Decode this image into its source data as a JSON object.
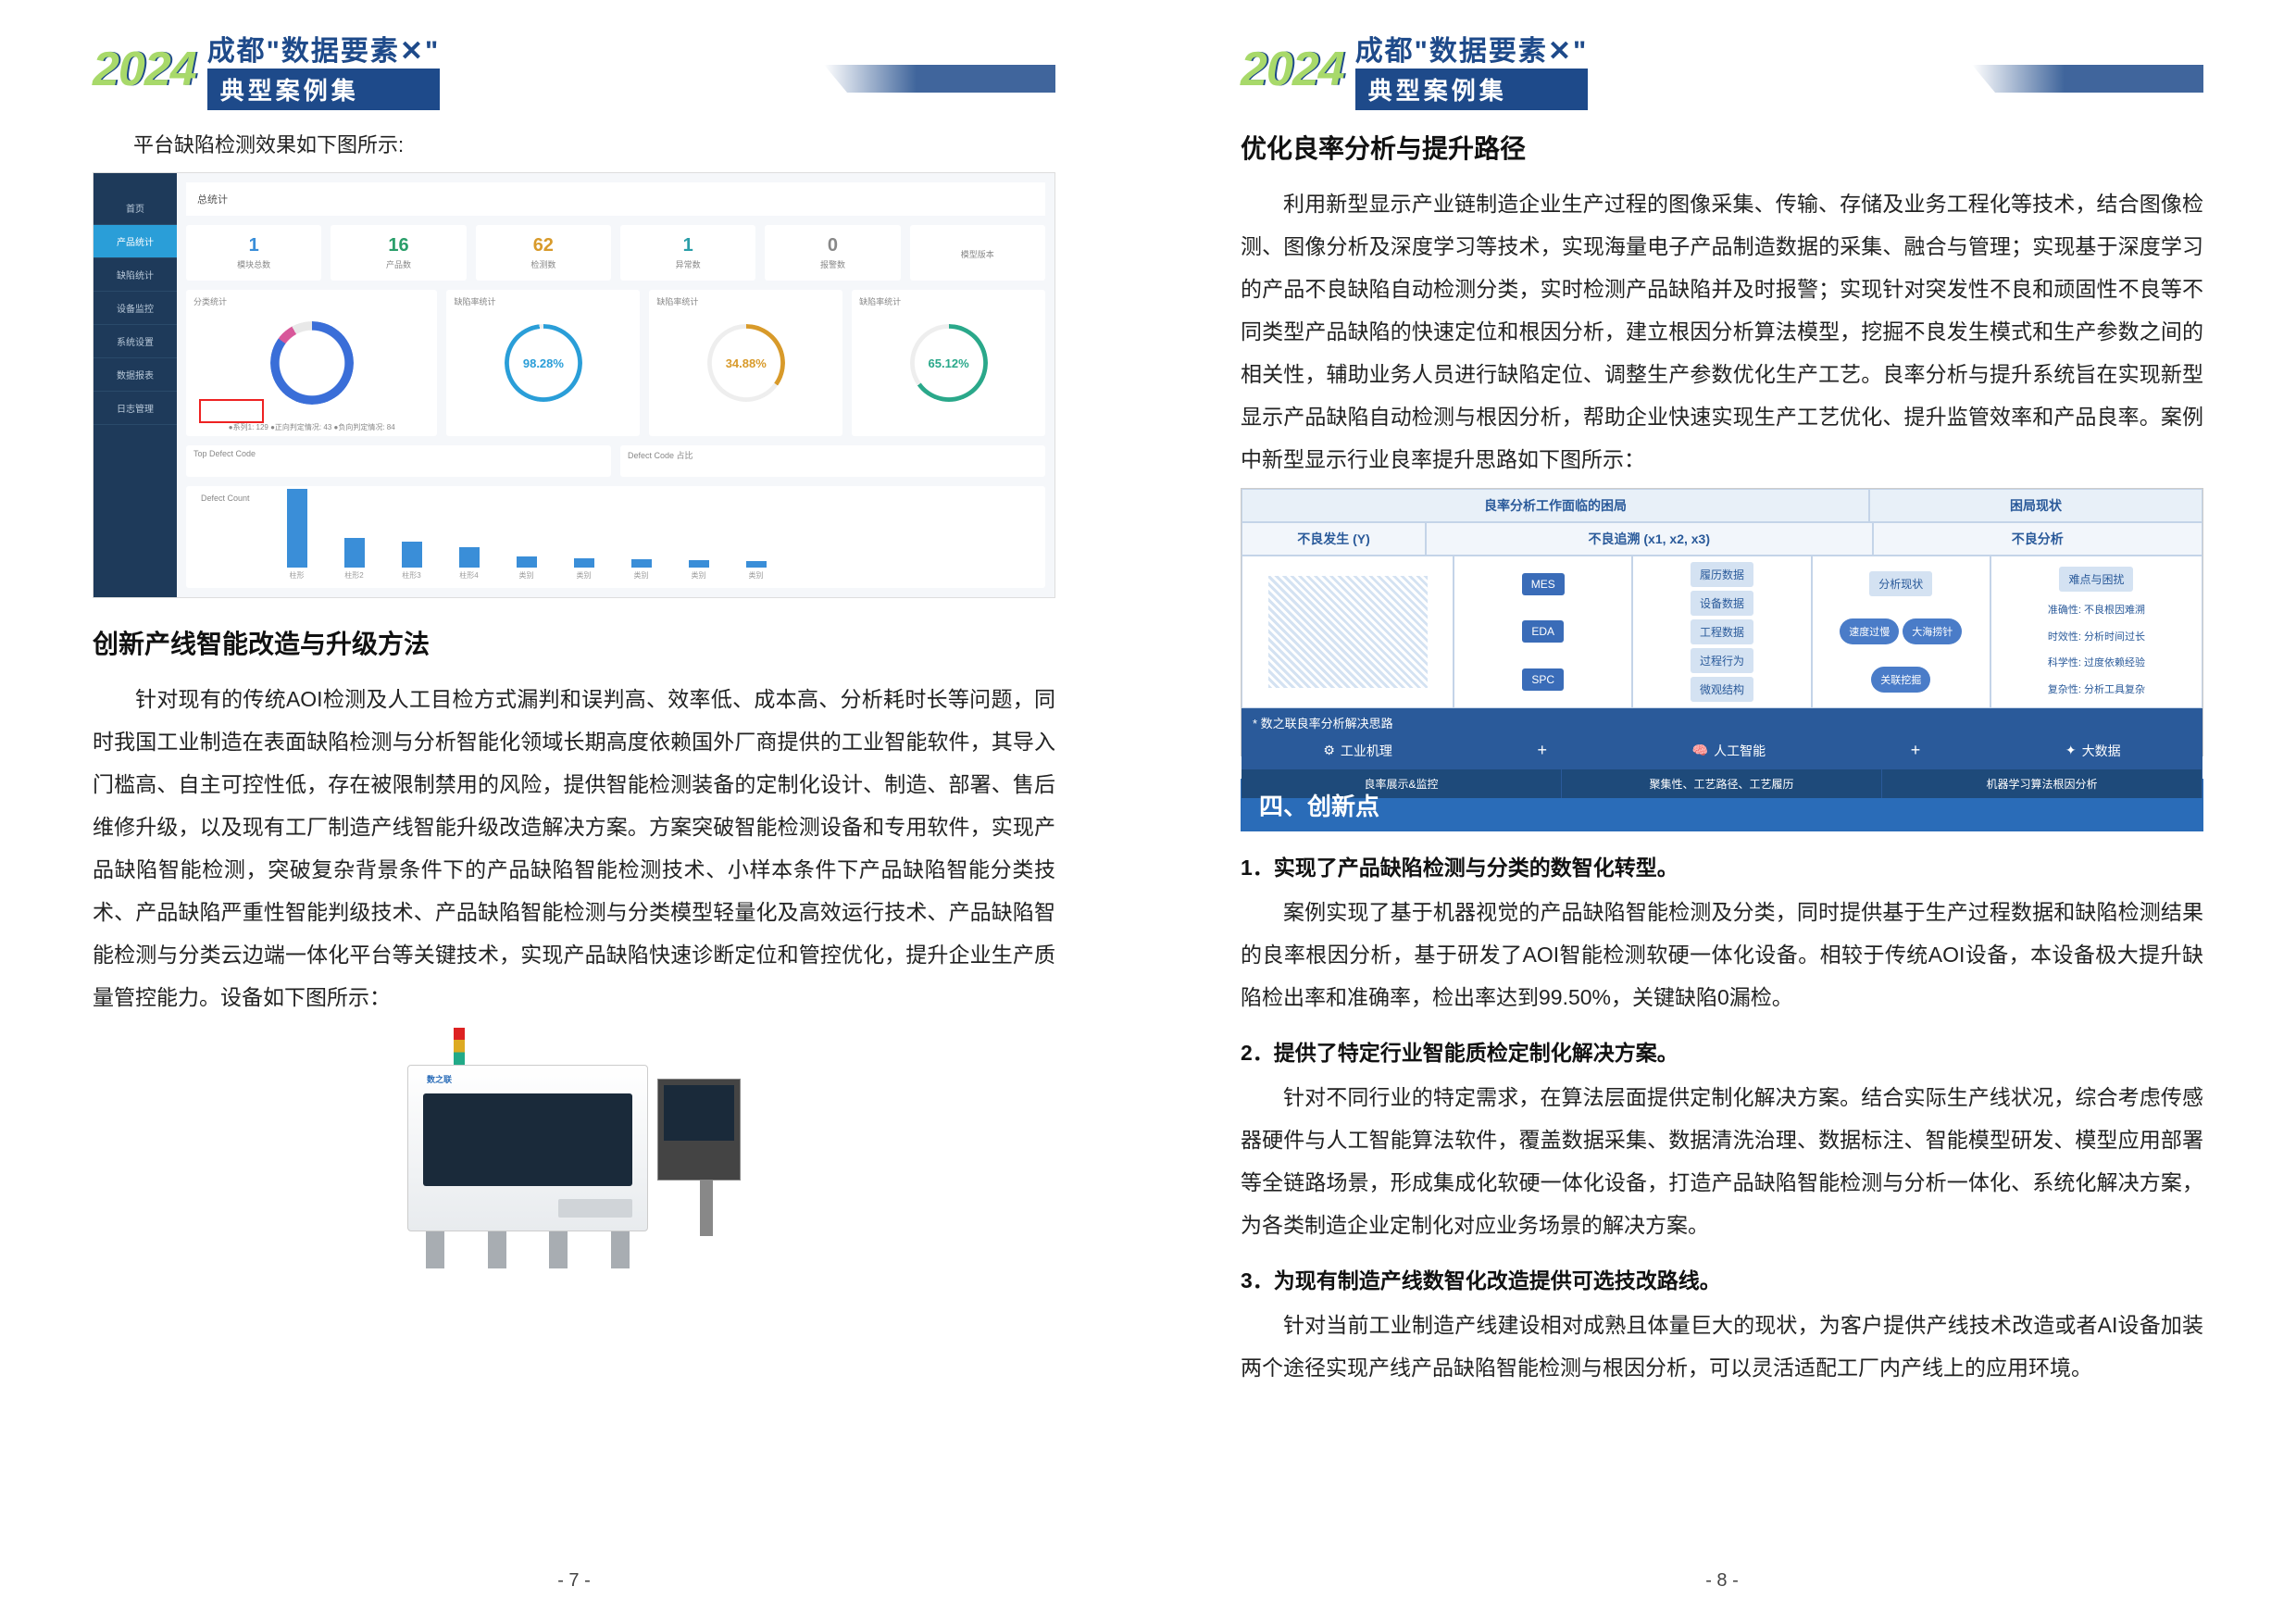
{
  "header": {
    "year": "2024",
    "title_top": "成都\"数据要素✕\"",
    "title_bottom": "典型案例集"
  },
  "left": {
    "caption1": "平台缺陷检测效果如下图所示:",
    "section1_title": "创新产线智能改造与升级方法",
    "para1": "针对现有的传统AOI检测及人工目检方式漏判和误判高、效率低、成本高、分析耗时长等问题，同时我国工业制造在表面缺陷检测与分析智能化领域长期高度依赖国外厂商提供的工业智能软件，其导入门槛高、自主可控性低，存在被限制禁用的风险，提供智能检测装备的定制化设计、制造、部署、售后维修升级，以及现有工厂制造产线智能升级改造解决方案。方案突破智能检测设备和专用软件，实现产品缺陷智能检测，突破复杂背景条件下的产品缺陷智能检测技术、小样本条件下产品缺陷智能分类技术、产品缺陷严重性智能判级技术、产品缺陷智能检测与分类模型轻量化及高效运行技术、产品缺陷智能检测与分类云边端一体化平台等关键技术，实现产品缺陷快速诊断定位和管控优化，提升企业生产质量管控能力。设备如下图所示：",
    "page_num": "- 7 -",
    "dashboard": {
      "top_label": "总统计",
      "sidebar": [
        "首页",
        "产品统计",
        "缺陷统计",
        "设备监控",
        "系统设置",
        "数据报表",
        "日志管理"
      ],
      "stats": [
        {
          "val": "1",
          "lbl": "模块总数"
        },
        {
          "val": "16",
          "lbl": "产品数"
        },
        {
          "val": "62",
          "lbl": "检测数"
        },
        {
          "val": "1",
          "lbl": "异常数"
        },
        {
          "val": "0",
          "lbl": "报警数"
        },
        {
          "val": "",
          "lbl": "模型版本"
        }
      ],
      "gauges": {
        "main_lbl": "分类统计",
        "g1_lbl": "缺陷率统计",
        "g1": "98.28%",
        "g2_lbl": "缺陷率统计",
        "g2": "34.88%",
        "g3_lbl": "缺陷率统计",
        "g3": "65.12%"
      },
      "legend": "●系列1: 129  ●正向判定情况: 43  ●负向判定情况: 84",
      "row3": {
        "l": "Top Defect Code",
        "r": "Defect Code 占比"
      },
      "bar_title": "Defect Count",
      "bars": [
        {
          "h": 85,
          "lbl": "柱形"
        },
        {
          "h": 32,
          "lbl": "柱形2"
        },
        {
          "h": 28,
          "lbl": "柱形3"
        },
        {
          "h": 22,
          "lbl": "柱形4"
        },
        {
          "h": 12,
          "lbl": "类别"
        },
        {
          "h": 10,
          "lbl": "类别"
        },
        {
          "h": 9,
          "lbl": "类别"
        },
        {
          "h": 8,
          "lbl": "类别"
        },
        {
          "h": 7,
          "lbl": "类别"
        }
      ]
    },
    "machine_brand": "数之联"
  },
  "right": {
    "section1_title": "优化良率分析与提升路径",
    "para1": "利用新型显示产业链制造企业生产过程的图像采集、传输、存储及业务工程化等技术，结合图像检测、图像分析及深度学习等技术，实现海量电子产品制造数据的采集、融合与管理；实现基于深度学习的产品不良缺陷自动检测分类，实时检测产品缺陷并及时报警；实现针对突发性不良和顽固性不良等不同类型产品缺陷的快速定位和根因分析，建立根因分析算法模型，挖掘不良发生模式和生产参数之间的相关性，辅助业务人员进行缺陷定位、调整生产参数优化生产工艺。良率分析与提升系统旨在实现新型显示产品缺陷自动检测与根因分析，帮助企业快速实现生产工艺优化、提升监管效率和产品良率。案例中新型显示行业良率提升思路如下图所示：",
    "section_bar": "四、创新点",
    "p1_title": "1．实现了产品缺陷检测与分类的数智化转型。",
    "p1_body": "案例实现了基于机器视觉的产品缺陷智能检测及分类，同时提供基于生产过程数据和缺陷检测结果的良率根因分析，基于研发了AOI智能检测软硬一体化设备。相较于传统AOI设备，本设备极大提升缺陷检出率和准确率，检出率达到99.50%，关键缺陷0漏检。",
    "p2_title": "2．提供了特定行业智能质检定制化解决方案。",
    "p2_body": "针对不同行业的特定需求，在算法层面提供定制化解决方案。结合实际生产线状况，综合考虑传感器硬件与人工智能算法软件，覆盖数据采集、数据清洗治理、数据标注、智能模型研发、模型应用部署等全链路场景，形成集成化软硬一体化设备，打造产品缺陷智能检测与分析一体化、系统化解决方案，为各类制造企业定制化对应业务场景的解决方案。",
    "p3_title": "3．为现有制造产线数智化改造提供可选技改路线。",
    "p3_body": "针对当前工业制造产线建设相对成熟且体量巨大的现状，为客户提供产线技术改造或者AI设备加装两个途径实现产线产品缺陷智能检测与根因分析，可以灵活适配工厂内产线上的应用环境。",
    "page_num": "- 8 -",
    "flow": {
      "head1": "良率分析工作面临的困局",
      "head2": "困局现状",
      "sub1": "不良发生 (Y)",
      "sub2": "不良追溯 (x1, x2, x3)",
      "sub3": "不良分析",
      "col1": [
        "MES",
        "EDA",
        "SPC"
      ],
      "col2": [
        "履历数据",
        "设备数据",
        "工程数据",
        "过程行为",
        "微观结构"
      ],
      "col3": [
        "分析现状",
        "速度过慢",
        "大海捞针",
        "关联挖掘"
      ],
      "col3_top": "难点与困扰",
      "col4": [
        "准确性: 不良根因难溯",
        "时效性: 分析时间过长",
        "科学性: 过度依赖经验",
        "复杂性: 分析工具复杂"
      ],
      "bot_title": "* 数之联良率分析解决思路",
      "icons": [
        "工业机理",
        "人工智能",
        "大数据"
      ],
      "bot_bar": [
        "良率展示&监控",
        "聚集性、工艺路径、工艺履历",
        "机器学习算法根因分析"
      ]
    }
  }
}
